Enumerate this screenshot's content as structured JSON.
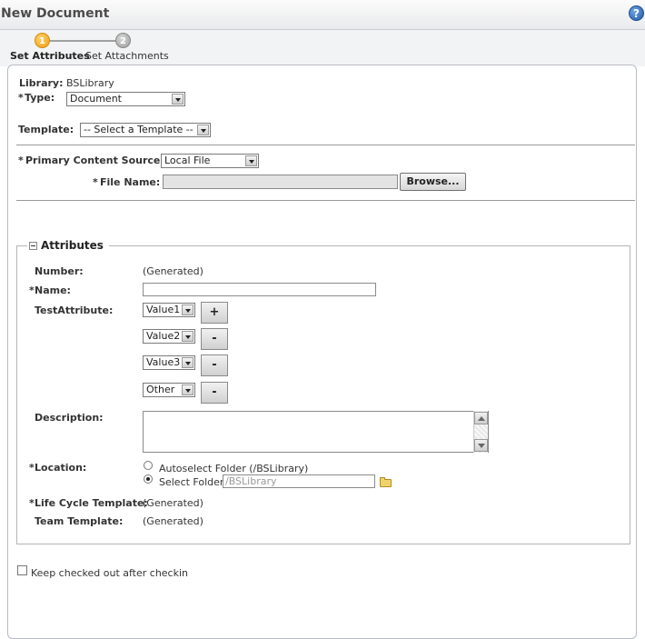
{
  "window": {
    "title": "New Document",
    "help_icon": "help-icon"
  },
  "steps": [
    {
      "number": "1",
      "label": "Set Attributes",
      "active": true
    },
    {
      "number": "2",
      "label": "Set Attachments",
      "active": false
    }
  ],
  "form": {
    "library_label": "Library:",
    "library_value": "BSLibrary",
    "type_label": "Type:",
    "type_value": "Document",
    "template_label": "Template:",
    "template_value": "-- Select a Template --",
    "primary_source_label": "Primary Content Source:",
    "primary_source_value": "Local File",
    "file_name_label": "File Name:",
    "file_name_value": "",
    "browse_label": "Browse..."
  },
  "attributes": {
    "section_title": "Attributes",
    "number_label": "Number:",
    "number_value": "(Generated)",
    "name_label": "Name:",
    "name_value": "",
    "test_attribute_label": "TestAttribute:",
    "test_values": [
      {
        "value": "Value1",
        "button": "+"
      },
      {
        "value": "Value2",
        "button": "-"
      },
      {
        "value": "Value3",
        "button": "-"
      },
      {
        "value": "Other",
        "button": "-"
      }
    ],
    "description_label": "Description:",
    "description_value": "",
    "location_label": "Location:",
    "autoselect_label": "Autoselect Folder (/BSLibrary)",
    "select_folder_label": "Select Folder",
    "select_folder_value": "/BSLibrary",
    "lifecycle_label": "Life Cycle Template:",
    "lifecycle_value": "(Generated)",
    "team_label": "Team Template:",
    "team_value": "(Generated)"
  },
  "keep_checked_out_label": "Keep checked out after checkin",
  "required_marker": "*"
}
